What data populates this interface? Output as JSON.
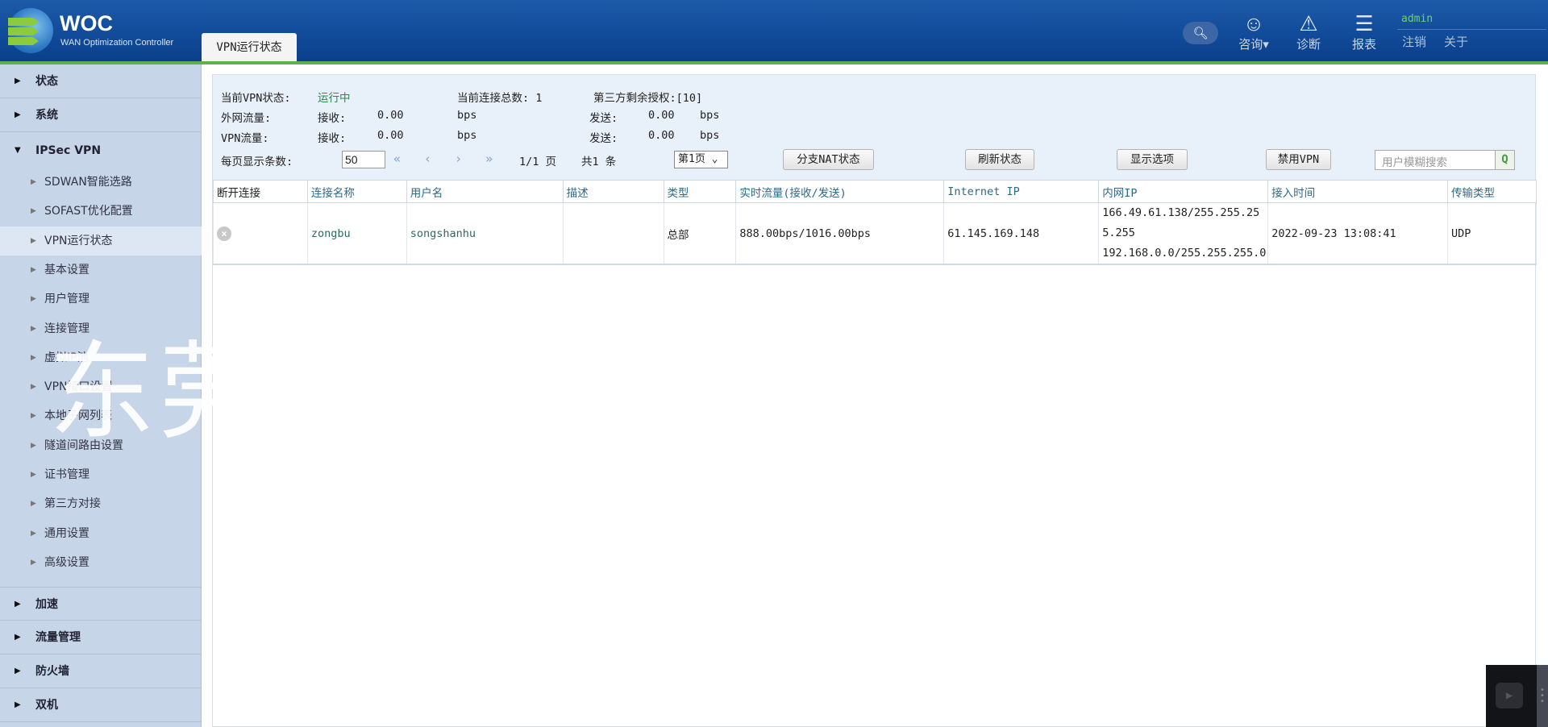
{
  "header": {
    "brand": "WOC",
    "brand_sub": "WAN Optimization Controller",
    "active_tab": "VPN运行状态",
    "consult": "咨询",
    "diagnose": "诊断",
    "report": "报表",
    "user": "admin",
    "logout": "注销",
    "about": "关于"
  },
  "sidebar": {
    "top_before": [
      {
        "label": "状态"
      },
      {
        "label": "系统"
      }
    ],
    "expanded": "IPSec VPN",
    "subs": [
      "SDWAN智能选路",
      "SOFAST优化配置",
      "VPN运行状态",
      "基本设置",
      "用户管理",
      "连接管理",
      "虚拟IP池",
      "VPN接口设置",
      "本地子网列表",
      "隧道间路由设置",
      "证书管理",
      "第三方对接",
      "通用设置",
      "高级设置"
    ],
    "top_after": [
      "加速",
      "流量管理",
      "防火墙",
      "双机"
    ]
  },
  "info": {
    "vpn_status_label": "当前VPN状态:",
    "vpn_status": "运行中",
    "conn_total": "当前连接总数: 1",
    "third_party": "第三方剩余授权:[10]",
    "wan_label": "外网流量:",
    "vpn_label": "VPN流量:",
    "recv": "接收:",
    "send": "发送:",
    "unit": "bps",
    "wan_recv": "0.00",
    "wan_send": "0.00",
    "vpn_recv": "0.00",
    "vpn_send": "0.00",
    "per_page_label": "每页显示条数:",
    "per_page": "50",
    "page_info": "1/1 页",
    "total": "共1 条",
    "page_select": "第1页",
    "pager_arrows": "« ‹ › »"
  },
  "buttons": {
    "nat": "分支NAT状态",
    "refresh": "刷新状态",
    "options": "显示选项",
    "disable": "禁用VPN",
    "search_placeholder": "用户模糊搜索"
  },
  "table": {
    "headers": [
      "断开连接",
      "连接名称",
      "用户名",
      "描述",
      "类型",
      "实时流量(接收/发送)",
      "Internet IP",
      "内网IP",
      "接入时间",
      "传输类型"
    ],
    "rows": [
      {
        "name": "zongbu",
        "user": "songshanhu",
        "desc": "",
        "type": "总部",
        "traffic": "888.00bps/1016.00bps",
        "internet_ip": "61.145.169.148",
        "lan_ip_1": "166.49.61.138/255.255.25",
        "lan_ip_2": "5.255",
        "lan_ip_3": "192.168.0.0/255.255.255.0",
        "time": "2022-09-23 13:08:41",
        "transport": "UDP"
      }
    ]
  },
  "watermark": "东莞市昊群计算机有限公司"
}
